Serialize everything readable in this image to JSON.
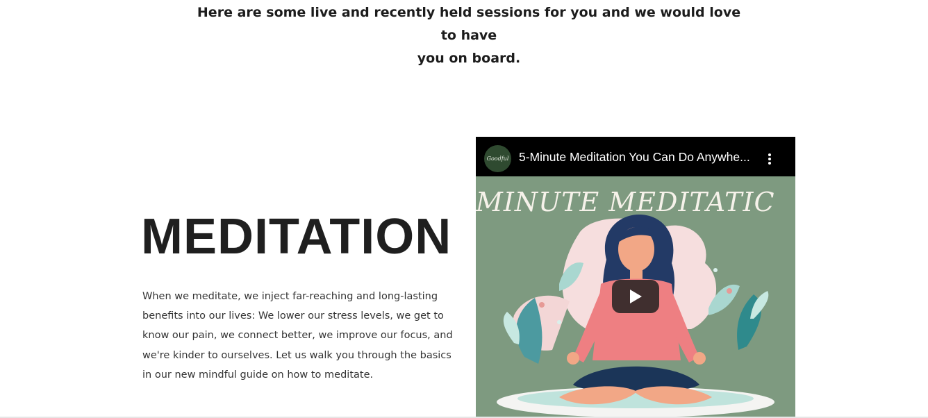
{
  "intro": {
    "line1": "Here are some live and recently held sessions for you and we would love to have",
    "line2": "you on board."
  },
  "section": {
    "heading": "MEDITATION",
    "body": "When we meditate, we inject far-reaching and long-lasting benefits into our lives: We lower our stress levels, we get to know our pain, we connect better, we improve our focus, and we're kinder to ourselves. Let us walk you through the basics in our new mindful guide on how to meditate."
  },
  "video": {
    "title": "5-Minute Meditation You Can Do Anywhe...",
    "channel_logo_text": "Goodful",
    "thumbnail_text": "MINUTE MEDITATIC",
    "menu_icon": "more-vertical-icon",
    "play_icon": "play-icon",
    "colors": {
      "bar": "#000000",
      "thumbnail_bg": "#7e9a80",
      "play_button": "#212121"
    }
  }
}
